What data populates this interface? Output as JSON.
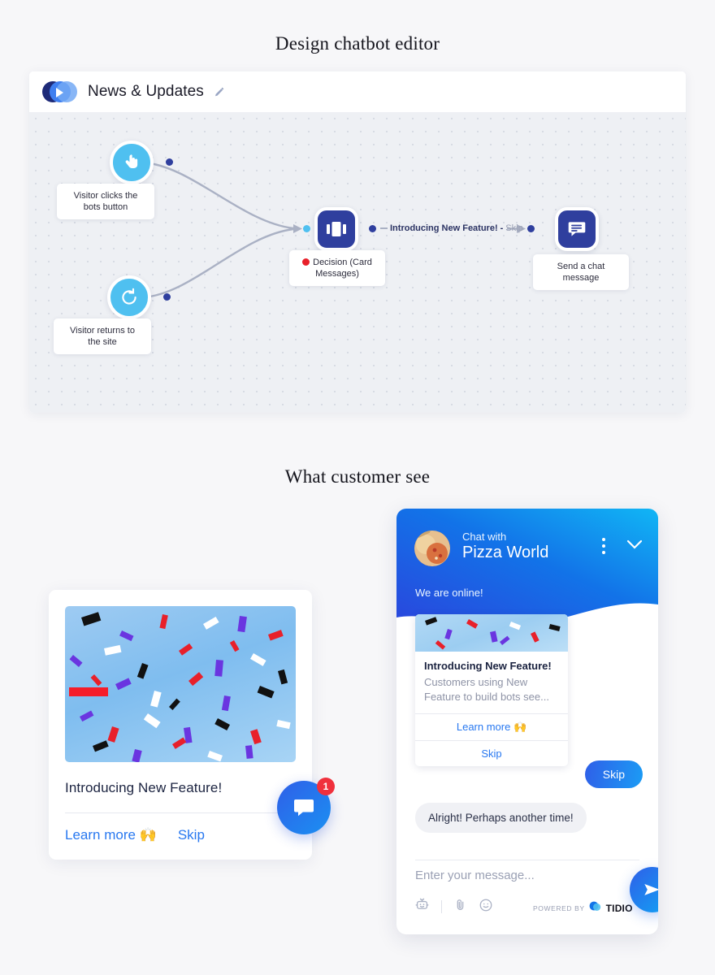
{
  "sections": {
    "design_title": "Design chatbot editor",
    "customer_title": "What customer see"
  },
  "editor": {
    "bot_name": "News & Updates",
    "edit_icon": "pencil-icon",
    "logo_icon": "tidio-logo-icon",
    "nodes": [
      {
        "id": "trigger-click",
        "label": "Visitor clicks the\nbots button",
        "icon": "tap-hand-icon",
        "type": "trigger"
      },
      {
        "id": "trigger-return",
        "label": "Visitor returns to\nthe site",
        "icon": "refresh-arrow-icon",
        "type": "trigger"
      },
      {
        "id": "decision-card",
        "label": "Decision (Card Messages)",
        "icon": "cards-carousel-icon",
        "type": "decision",
        "status_color": "#e8202a"
      },
      {
        "id": "send-message",
        "label": "Send a chat\nmessage",
        "icon": "chat-message-icon",
        "type": "action"
      }
    ],
    "node_labels": {
      "trigger_click_line1": "Visitor clicks the",
      "trigger_click_line2": "bots button",
      "trigger_return_line1": "Visitor returns to",
      "trigger_return_line2": "the site",
      "decision_line1": "Decision (Card",
      "decision_line2": "Messages)",
      "send_line1": "Send a chat",
      "send_line2": "message"
    },
    "edge_label": {
      "main": "Introducing New Feature!",
      "separator": "-",
      "alt": "Skip"
    }
  },
  "preview_card": {
    "image_alt": "confetti-image",
    "title": "Introducing New Feature!",
    "learn_more": "Learn more 🙌",
    "skip": "Skip"
  },
  "launcher": {
    "icon": "chat-bubble-icon",
    "badge_count": "1"
  },
  "widget": {
    "header": {
      "chat_with": "Chat with",
      "company": "Pizza World",
      "status": "We are online!",
      "avatar_icon": "pizza-avatar",
      "menu_icon": "kebab-menu-icon",
      "collapse_icon": "chevron-down-icon"
    },
    "card_message": {
      "title": "Introducing New Feature!",
      "description": "Customers using New Feature to build bots see...",
      "learn_more": "Learn more 🙌",
      "skip": "Skip"
    },
    "messages": [
      {
        "from": "visitor",
        "text": "Skip"
      },
      {
        "from": "bot",
        "text": "Alright! Perhaps another time!"
      }
    ],
    "visitor_reply": "Skip",
    "bot_reply": "Alright! Perhaps another time!",
    "input_placeholder": "Enter your message...",
    "footer": {
      "bot_icon": "bot-icon",
      "attach_icon": "paperclip-icon",
      "emoji_icon": "smiley-icon",
      "powered_by": "POWERED BY",
      "brand": "TIDIO",
      "send_icon": "send-plane-icon"
    }
  },
  "colors": {
    "page_bg": "#f7f7f9",
    "canvas_bg": "#eef0f4",
    "trigger_blue": "#4fc0f0",
    "node_navy": "#2f3f9e",
    "link_blue": "#2878f0",
    "badge_red": "#f0303c",
    "decision_red": "#e8202a"
  }
}
